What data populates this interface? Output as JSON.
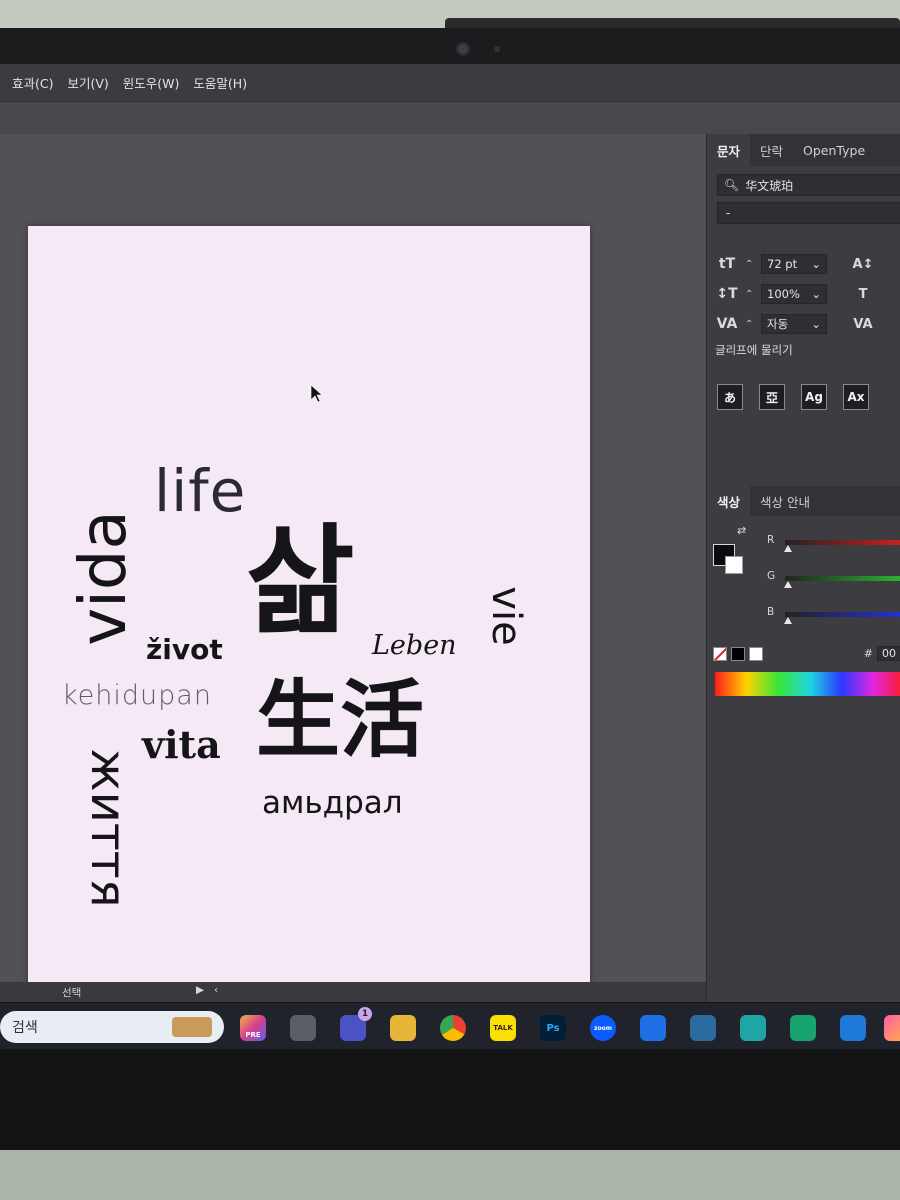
{
  "menubar": {
    "items": [
      "효과(C)",
      "보기(V)",
      "윈도우(W)",
      "도움말(H)"
    ]
  },
  "artboard": {
    "words": {
      "life": "life",
      "sam": "삶",
      "vida": "vida",
      "vie": "vie",
      "zivot": "život",
      "leben": "Leben",
      "kehidupan": "kehidupan",
      "sheng": "生活",
      "vita": "vita",
      "zhyttia": "життя",
      "amdral": "амьдрал"
    }
  },
  "panel": {
    "tabs": [
      "문자",
      "단락",
      "OpenType"
    ],
    "font_family": "华文琥珀",
    "font_style": "-",
    "font_size": "72 pt",
    "vertical_scale": "100%",
    "tracking": "자동",
    "glyph_label": "글리프에 물리기",
    "glyph_buttons": [
      "あ",
      "亞",
      "Ag",
      "Ax"
    ],
    "color_tabs": [
      "색상",
      "색상 안내"
    ],
    "slider_labels": [
      "R",
      "G",
      "B"
    ],
    "hex_prefix": "#",
    "hex_value": "00"
  },
  "statusbar": {
    "tool": "선택"
  },
  "taskbar": {
    "search_placeholder": "검색",
    "icons": [
      "PRE",
      "1",
      "TALK",
      "Ps",
      "zoom"
    ]
  },
  "colors": {
    "accent_red": "#e01f1f",
    "accent_green": "#2fc42f",
    "accent_blue": "#2333e8",
    "artboard_bg": "#f4e9f4"
  }
}
